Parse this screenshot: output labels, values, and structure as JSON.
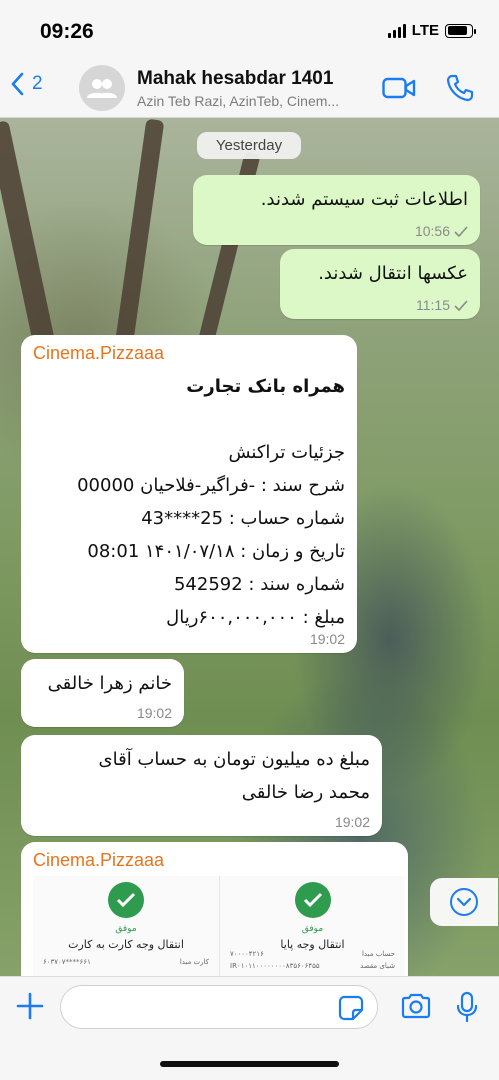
{
  "status_bar": {
    "time": "09:26",
    "network": "LTE",
    "battery_level": 0.85
  },
  "header": {
    "back_count": "2",
    "title": "Mahak hesabdar 1401",
    "subtitle": "Azin Teb Razi, AzinTeb, Cinem..."
  },
  "chat": {
    "date_divider": "Yesterday",
    "messages": [
      {
        "text": "اطلاعات ثبت سیستم شدند.",
        "time": "10:56"
      },
      {
        "text": "عکسها انتقال شدند.",
        "time": "11:15"
      },
      {
        "sender": "Cinema.Pizzaaa",
        "lines": [
          "همراه بانک تجارت",
          "جزئیات تراکنش",
          "شرح سند : -فراگیر-فلاحیان 00000",
          "شماره حساب : 25****43",
          "تاریخ و زمان : ۱۴۰۱/۰۷/۱۸ 08:01",
          "شماره سند : 542592",
          "مبلغ : ۶۰۰,۰۰۰,۰۰۰ریال"
        ],
        "time": "19:02"
      },
      {
        "text": "خانم زهرا خالقی",
        "time": "19:02"
      },
      {
        "lines": [
          "مبلغ ده میلیون تومان به حساب آقای",
          "محمد رضا خالقی"
        ],
        "time": "19:02"
      },
      {
        "sender": "Cinema.Pizzaaa",
        "receipt": {
          "left_status": "موفق",
          "left_title": "انتقال وجه کارت به کارت",
          "left_label": "کارت مبدا",
          "left_value": "۶۰۳۷۰۷****۶۶۱",
          "right_status": "موفق",
          "right_title": "انتقال وجه پایا",
          "right_label_1": "حساب مبدا",
          "right_value_1": "۷۰۰۰۰۴۲۱۶",
          "right_label_2": "شبای مقصد",
          "right_value_2": "IR۰۱۰۱۱۰۰۰۰۰۰۰۰۸۳۵۶۰۶۴۵۵"
        }
      }
    ]
  },
  "input": {
    "placeholder": ""
  },
  "colors": {
    "accent": "#1a7cf0",
    "outgoing_bubble": "#dcf8c6",
    "sender_name": "#e8741c",
    "success": "#2e9b4e"
  }
}
